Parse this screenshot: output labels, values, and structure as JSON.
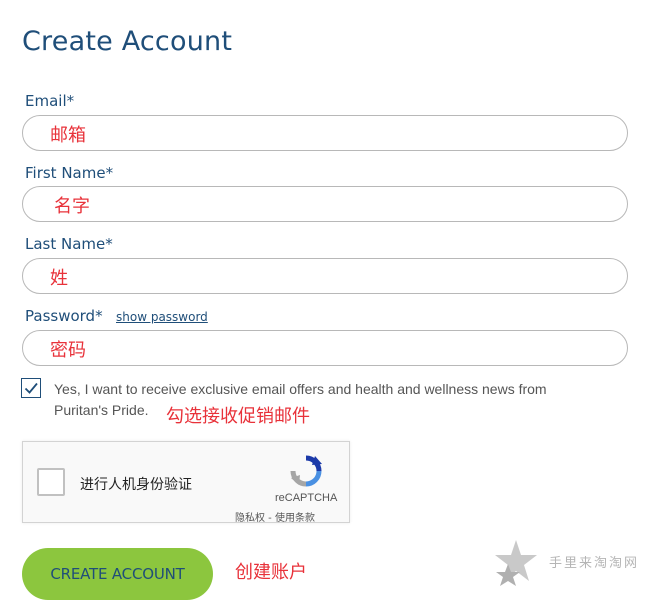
{
  "form": {
    "title": "Create Account",
    "email": {
      "label": "Email*",
      "value": "邮箱"
    },
    "first_name": {
      "label": "First Name*",
      "value": "名字"
    },
    "last_name": {
      "label": "Last Name*",
      "value": "姓"
    },
    "password": {
      "label": "Password*",
      "show_password": "show password",
      "value": "密码"
    },
    "consent": {
      "checked": true,
      "text_line1": "Yes, I want to receive exclusive email offers and health and wellness news from",
      "text_line2": "Puritan's Pride.",
      "annotation": "勾选接收促销邮件"
    },
    "recaptcha": {
      "label": "进行人机身份验证",
      "brand": "reCAPTCHA",
      "links": "隐私权 - 使用条款"
    },
    "submit": {
      "label": "CREATE ACCOUNT",
      "annotation": "创建账户"
    }
  },
  "watermark": {
    "text": "手里来淘淘网"
  },
  "colors": {
    "primary": "#1f4e79",
    "button": "#8cc63e",
    "annotation": "#e8323a"
  }
}
